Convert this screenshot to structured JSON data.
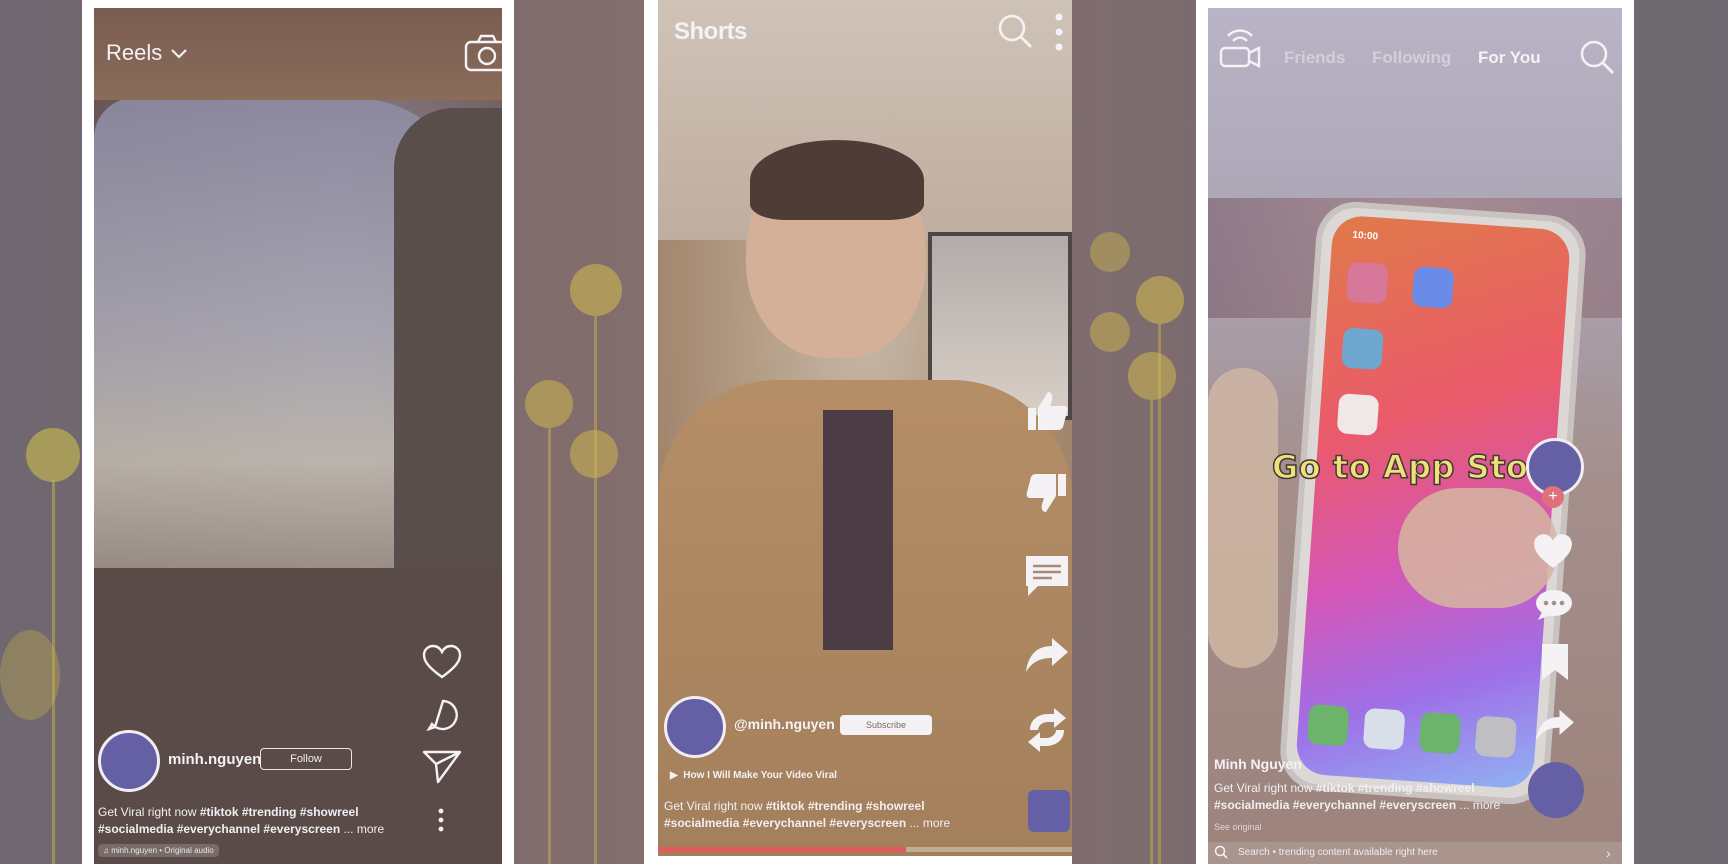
{
  "colors": {
    "accent": "#6560a6",
    "progress": "#e05b5b",
    "overlay_text": "#f1e07a"
  },
  "reels": {
    "title": "Reels",
    "username": "minh.nguyen",
    "follow_label": "Follow",
    "caption_plain": "Get Viral right now ",
    "caption_tags_1": "#tiktok #trending #showreel",
    "caption_tags_2": "#socialmedia #everychannel #everyscreen",
    "caption_more": " ... more",
    "audio_label": "minh.nguyen • Original audio",
    "icons": [
      "chevron-down-icon",
      "camera-icon",
      "heart-icon",
      "comment-icon",
      "send-icon",
      "more-icon"
    ]
  },
  "shorts": {
    "title": "Shorts",
    "channel": "@minh.nguyen",
    "subscribe_label": "Subscribe",
    "video_title": "How I Will Make Your Video Viral",
    "caption_plain": "Get Viral right now ",
    "caption_tags_1": "#tiktok #trending #showreel",
    "caption_tags_2": "#socialmedia #everychannel #everyscreen",
    "caption_more": " ... more",
    "progress": 0.6,
    "icons": [
      "search-icon",
      "more-vertical-icon",
      "like-icon",
      "dislike-icon",
      "comment-icon",
      "share-icon",
      "remix-icon"
    ]
  },
  "tiktok": {
    "tabs": [
      "Friends",
      "Following",
      "For You"
    ],
    "active_tab": "For You",
    "overlay_text": "Go to App Store",
    "author": "Minh Nguyen",
    "caption_plain": "Get Viral right now ",
    "caption_tags_1": "#tiktok #trending #showreel",
    "caption_tags_2": "#socialmedia #everychannel #everyscreen",
    "caption_more": " ... more",
    "see_original": "See original",
    "search_placeholder": "Search • trending content available right here",
    "phone_time": "10:00",
    "icons": [
      "live-icon",
      "search-icon",
      "plus-icon",
      "heart-icon",
      "comment-icon",
      "bookmark-icon",
      "share-icon"
    ]
  }
}
